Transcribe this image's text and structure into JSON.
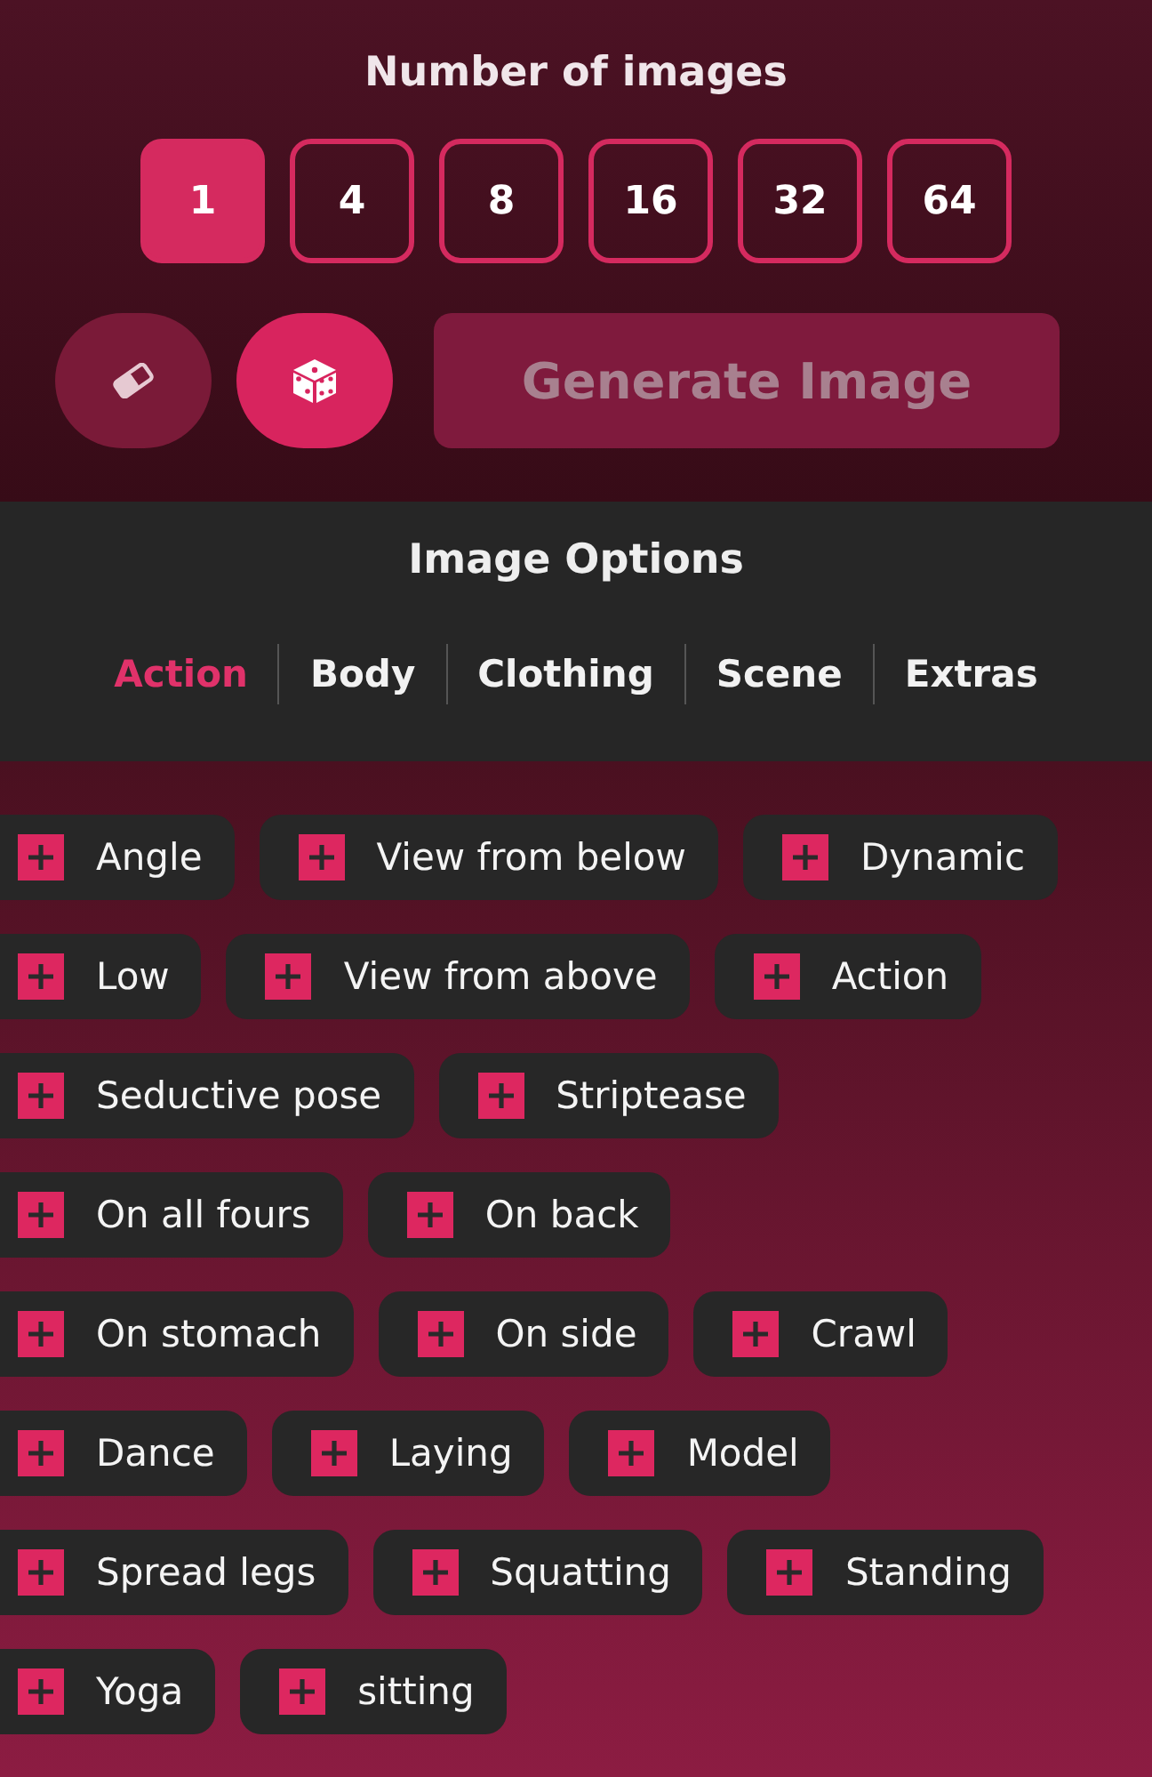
{
  "count_picker": {
    "title": "Number of images",
    "options": [
      {
        "label": "1",
        "selected": true
      },
      {
        "label": "4",
        "selected": false
      },
      {
        "label": "8",
        "selected": false
      },
      {
        "label": "16",
        "selected": false
      },
      {
        "label": "32",
        "selected": false
      },
      {
        "label": "64",
        "selected": false
      }
    ]
  },
  "actions": {
    "eraser": {
      "disabled": true
    },
    "dice": {
      "disabled": false
    },
    "generate": {
      "label": "Generate Image",
      "disabled": true
    }
  },
  "options_panel": {
    "title": "Image Options",
    "tabs": [
      {
        "label": "Action",
        "selected": true
      },
      {
        "label": "Body",
        "selected": false
      },
      {
        "label": "Clothing",
        "selected": false
      },
      {
        "label": "Scene",
        "selected": false
      },
      {
        "label": "Extras",
        "selected": false
      }
    ]
  },
  "tag_rows": [
    [
      "Angle",
      "View from below",
      "Dynamic"
    ],
    [
      "Low",
      "View from above",
      "Action"
    ],
    [
      "Seductive pose",
      "Striptease"
    ],
    [
      "On all fours",
      "On back"
    ],
    [
      "On stomach",
      "On side",
      "Crawl"
    ],
    [
      "Dance",
      "Laying",
      "Model"
    ],
    [
      "Spread legs",
      "Squatting",
      "Standing"
    ],
    [
      "Yoga",
      "sitting"
    ]
  ]
}
